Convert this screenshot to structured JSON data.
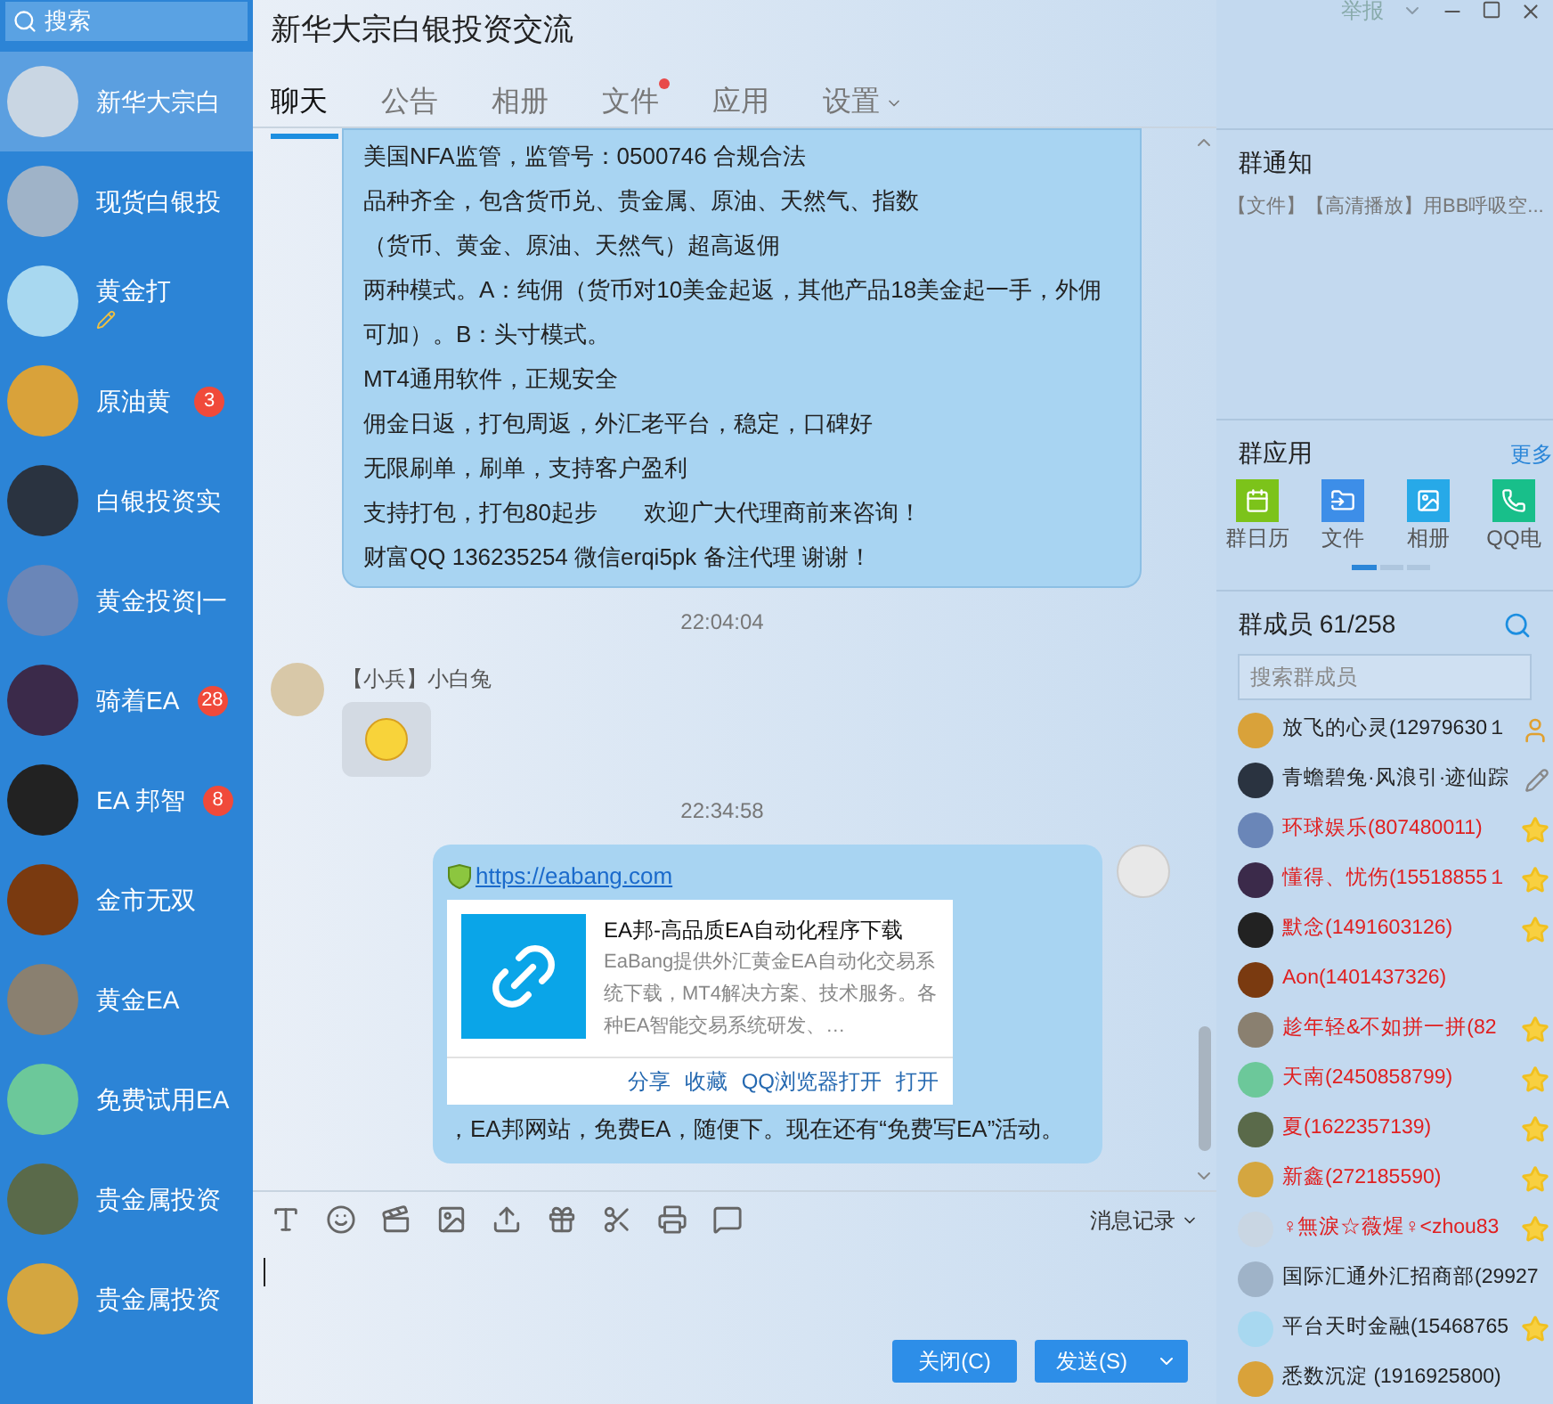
{
  "sidebar": {
    "search": {
      "placeholder": "搜索"
    },
    "items": [
      {
        "name": "新华大宗白",
        "selected": true,
        "draft": false
      },
      {
        "name": "现货白银投",
        "selected": false,
        "draft": false
      },
      {
        "name": "黄金打",
        "selected": false,
        "draft": true
      },
      {
        "name": "原油黄",
        "selected": false,
        "unread": "3",
        "draft": false
      },
      {
        "name": "白银投资实",
        "selected": false,
        "draft": false
      },
      {
        "name": "黄金投资|一",
        "selected": false,
        "draft": false
      },
      {
        "name": "骑着EA",
        "selected": false,
        "unread": "28",
        "draft": false
      },
      {
        "name": "EA 邦智",
        "selected": false,
        "unread": "8",
        "draft": false
      },
      {
        "name": "金市无双",
        "selected": false,
        "draft": false
      },
      {
        "name": "黄金EA",
        "selected": false,
        "draft": false
      },
      {
        "name": "免费试用EA",
        "selected": false,
        "draft": false
      },
      {
        "name": "贵金属投资",
        "selected": false,
        "draft": false
      },
      {
        "name": "贵金属投资",
        "selected": false,
        "draft": false
      }
    ]
  },
  "window": {
    "title": "新华大宗白银投资交流",
    "report": "举报"
  },
  "tabs": [
    {
      "label": "聊天",
      "selected": true,
      "dot": false,
      "menu": false
    },
    {
      "label": "公告",
      "selected": false,
      "dot": false,
      "menu": false
    },
    {
      "label": "相册",
      "selected": false,
      "dot": false,
      "menu": false
    },
    {
      "label": "文件",
      "selected": false,
      "dot": true,
      "menu": false
    },
    {
      "label": "应用",
      "selected": false,
      "dot": false,
      "menu": false
    },
    {
      "label": "设置",
      "selected": false,
      "dot": false,
      "menu": true
    }
  ],
  "chat": {
    "messages": [
      {
        "kind": "text",
        "lines": [
          "美国NFA监管，监管号：0500746 合规合法",
          "品种齐全，包含货币兑、贵金属、原油、天然气、指数",
          "（货币、黄金、原油、天然气）超高返佣",
          "两种模式。A：纯佣（货币对10美金起返，其他产品18美金起一手，外佣可加）。B：头寸模式。",
          "MT4通用软件，正规安全",
          "佣金日返，打包周返，外汇老平台，稳定，口碑好",
          "无限刷单，刷单，支持客户盈利",
          "支持打包，打包80起步　　欢迎广大代理商前来咨询！",
          "财富QQ  136235254  微信erqi5pk   备注代理 谢谢！"
        ]
      },
      {
        "kind": "time",
        "text": "22:04:04"
      },
      {
        "kind": "emoji",
        "sender": "【小兵】小白兔"
      },
      {
        "kind": "time",
        "text": "22:34:58"
      },
      {
        "kind": "link",
        "url": "https://eabang.com",
        "card_title": "EA邦-高品质EA自动化程序下载",
        "card_desc": "EaBang提供外汇黄金EA自动化交易系统下载，MT4解决方案、技术服务。各种EA智能交易系统研发、…",
        "actions": [
          "分享",
          "收藏",
          "QQ浏览器打开",
          "打开"
        ],
        "text": "，EA邦网站，免费EA，随便下。现在还有“免费写EA”活动。"
      }
    ]
  },
  "composer": {
    "history": "消息记录",
    "buttons": [
      "关闭(C)",
      "发送(S)"
    ]
  },
  "notice": {
    "title": "群通知",
    "text": "【文件】【高清播放】用BB呼吸空..."
  },
  "apps": {
    "title": "群应用",
    "more": "更多",
    "items": [
      {
        "label": "群日历",
        "color": "#7cc31a"
      },
      {
        "label": "文件",
        "color": "#3d8ee8"
      },
      {
        "label": "相册",
        "color": "#27a9e8"
      },
      {
        "label": "QQ电",
        "color": "#18bf8a"
      }
    ]
  },
  "members": {
    "title": "群成员 61/258",
    "search": {
      "placeholder": "搜索群成员"
    },
    "items": [
      {
        "name": "放飞的心灵(12979630１",
        "color": "#222222",
        "kind": "owner"
      },
      {
        "name": "青蟾碧兔·风浪引·迹仙踪",
        "color": "#222222",
        "kind": "editor"
      },
      {
        "name": "环球娱乐(807480011)",
        "color": "#e02020",
        "kind": "star"
      },
      {
        "name": "懂得、忧伤(15518855１",
        "color": "#e02020",
        "kind": "star"
      },
      {
        "name": "默念(1491603126)",
        "color": "#e02020",
        "kind": "star"
      },
      {
        "name": "Aon(1401437326)",
        "color": "#e02020",
        "kind": "plain"
      },
      {
        "name": "趁年轻&不如拼一拼(82",
        "color": "#e02020",
        "kind": "star"
      },
      {
        "name": "天南(2450858799)",
        "color": "#e02020",
        "kind": "star"
      },
      {
        "name": "夏(1622357139)",
        "color": "#e02020",
        "kind": "star"
      },
      {
        "name": "新鑫(272185590)",
        "color": "#e02020",
        "kind": "star"
      },
      {
        "name": "♀無淚☆薇煋♀<zhou83",
        "color": "#e02020",
        "kind": "star"
      },
      {
        "name": "国际汇通外汇招商部(29927",
        "color": "#222222",
        "kind": "plain"
      },
      {
        "name": "平台天时金融(15468765",
        "color": "#222222",
        "kind": "star"
      },
      {
        "name": "悉数沉淀 (1916925800)",
        "color": "#222222",
        "kind": "plain"
      }
    ]
  }
}
